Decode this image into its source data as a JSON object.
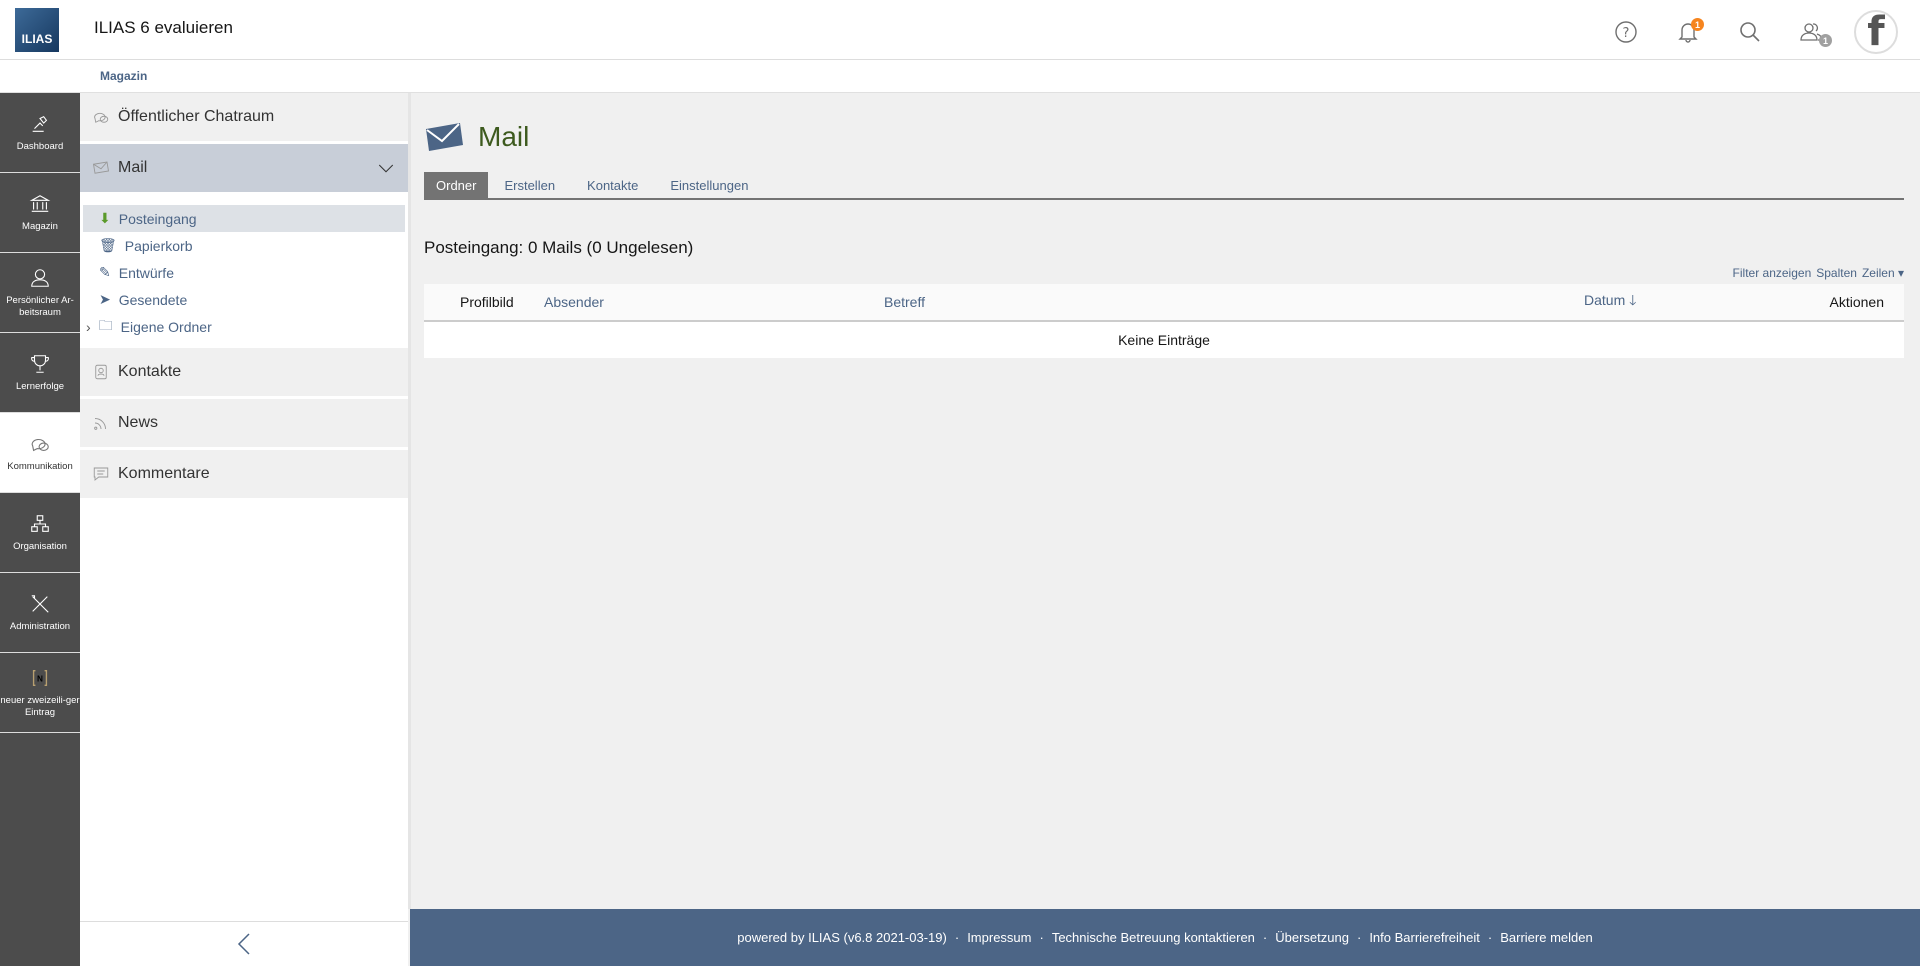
{
  "header": {
    "logo_text": "ILIAS",
    "title": "ILIAS 6 evaluieren",
    "notification_count": "1",
    "contacts_count": "1",
    "avatar_letter": "f"
  },
  "breadcrumb": [
    "Magazin"
  ],
  "mainbar": [
    {
      "label": "Dashboard",
      "icon": "dashboard-icon"
    },
    {
      "label": "Magazin",
      "icon": "repository-icon"
    },
    {
      "label": "Persönlicher Ar-beitsraum",
      "icon": "user-icon"
    },
    {
      "label": "Lernerfolge",
      "icon": "trophy-icon"
    },
    {
      "label": "Kommunikation",
      "icon": "chat-icon",
      "active": true
    },
    {
      "label": "Organisation",
      "icon": "org-icon"
    },
    {
      "label": "Administration",
      "icon": "tools-icon"
    },
    {
      "label": "neuer zweizeili-ger Eintrag",
      "icon": "n-icon"
    }
  ],
  "slate": {
    "chat": "Öffentlicher Chatraum",
    "mail": "Mail",
    "mail_items": [
      "Posteingang",
      "Papierkorb",
      "Entwürfe",
      "Gesendete",
      "Eigene Ordner"
    ],
    "contacts": "Kontakte",
    "news": "News",
    "comments": "Kommentare"
  },
  "page": {
    "title": "Mail",
    "tabs": [
      "Ordner",
      "Erstellen",
      "Kontakte",
      "Einstellungen"
    ],
    "heading": "Posteingang: 0 Mails (0 Ungelesen)",
    "tools": [
      "Filter anzeigen",
      "Spalten",
      "Zeilen ▾"
    ],
    "columns": [
      "Profilbild",
      "Absender",
      "Betreff",
      "Datum",
      "Aktionen"
    ],
    "empty": "Keine Einträge"
  },
  "footer": {
    "powered": "powered by ILIAS (v6.8 2021-03-19)",
    "links": [
      "Impressum",
      "Technische Betreuung kontaktieren",
      "Übersetzung",
      "Info Barrierefreiheit",
      "Barriere melden"
    ]
  },
  "colors": {
    "accent": "#4c6586",
    "mainbar": "#4c4c4c",
    "badge": "#f6851f",
    "title_green": "#3d5a1e"
  }
}
